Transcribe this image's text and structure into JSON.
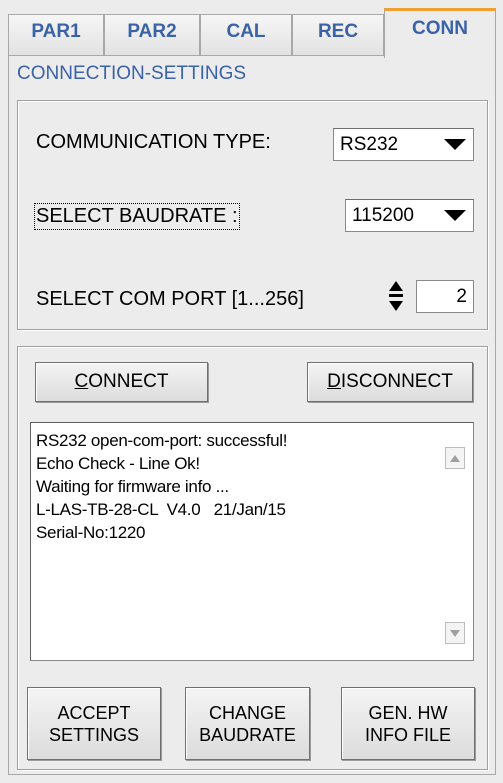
{
  "tabs": [
    {
      "label": "PAR1"
    },
    {
      "label": "PAR2"
    },
    {
      "label": "CAL"
    },
    {
      "label": "REC"
    },
    {
      "label": "CONN"
    }
  ],
  "active_tab": "CONN",
  "section_title": "CONNECTION-SETTINGS",
  "settings": {
    "communication_type_label": "COMMUNICATION TYPE:",
    "communication_type_value": "RS232",
    "baudrate_label": "SELECT BAUDRATE :",
    "baudrate_value": "115200",
    "com_port_label": "SELECT COM PORT [1...256]",
    "com_port_value": "2"
  },
  "connect": {
    "connect_first": "C",
    "connect_rest": "ONNECT",
    "disconnect_first": "D",
    "disconnect_rest": "ISCONNECT"
  },
  "log": {
    "lines": [
      "RS232 open-com-port: successful!",
      "Echo Check - Line Ok!",
      "Waiting for firmware info ...",
      "L-LAS-TB-28-CL  V4.0   21/Jan/15",
      "Serial-No:1220"
    ]
  },
  "actions": {
    "accept_line1": "ACCEPT",
    "accept_line2": "SETTINGS",
    "change_line1": "CHANGE",
    "change_line2": "BAUDRATE",
    "genhw_line1": "GEN. HW",
    "genhw_line2": "INFO FILE"
  },
  "colors": {
    "tab_text": "#3a62a8",
    "active_tab_accent": "#f0a030",
    "background": "#ececec"
  }
}
